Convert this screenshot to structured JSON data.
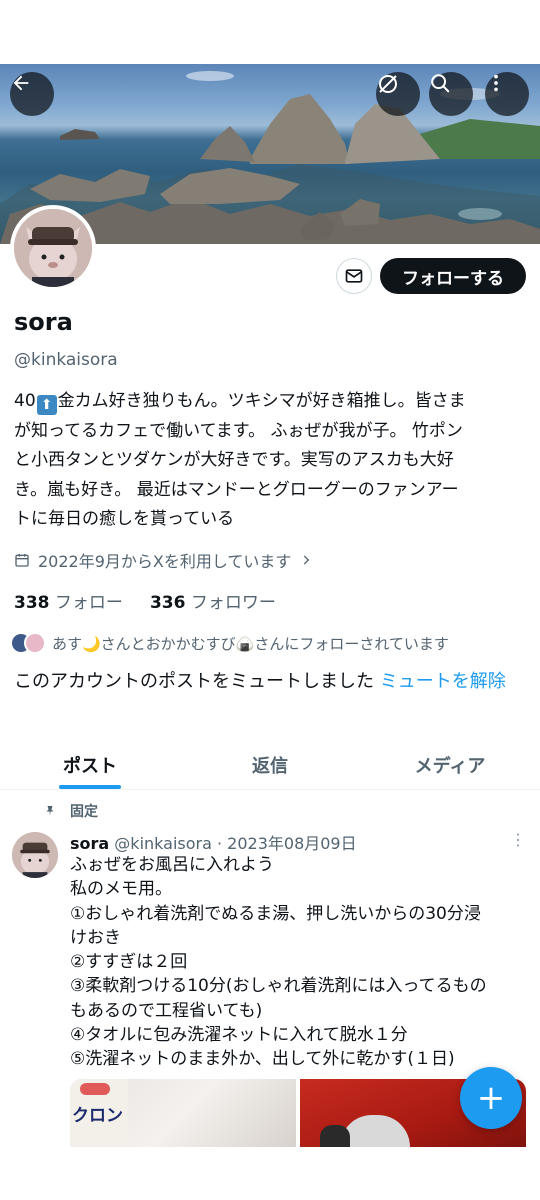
{
  "profile": {
    "name": "sora",
    "handle": "@kinkaisora",
    "follow_label": "フォローする",
    "bio_start": "40",
    "bio_up_emoji": "⬆",
    "bio_line1": "金カム好き独りもん。ツキシマが好き箱推し。皆さま",
    "bio_line2": "が知ってるカフェで働いてます。 ふぉぜが我が子。 竹ポン",
    "bio_line3": "と小西タンとツダケンが大好きです。実写のアスカも大好",
    "bio_line4": "き。嵐も好き。 最近はマンドーとグローグーのファンアー",
    "bio_line5": "トに毎日の癒しを貰っている",
    "joined": "2022年9月からXを利用しています",
    "following_count": "338",
    "following_label": "フォロー",
    "followers_count": "336",
    "followers_label": "フォロワー",
    "followed_by": "あす🌙さんとおかかむすび🍙さんにフォローされています",
    "muted_text": "このアカウントのポストをミュートしました",
    "unmute_label": "ミュートを解除"
  },
  "tabs": [
    {
      "label": "ポスト"
    },
    {
      "label": "返信"
    },
    {
      "label": "メディア"
    }
  ],
  "post": {
    "pinned_label": "固定",
    "author_name": "sora",
    "author_handle": "@kinkaisora",
    "separator": "·",
    "date": "2023年08月09日",
    "more": "⋮",
    "lines": [
      "ふぉぜをお風呂に入れよう",
      "私のメモ用。",
      "①おしゃれ着洗剤でぬるま湯、押し洗いからの30分浸",
      "けおき",
      "②すすぎは２回",
      "③柔軟剤つける10分(おしゃれ着洗剤には入ってるもの",
      "もあるので工程省いても)",
      "④タオルに包み洗濯ネットに入れて脱水１分",
      "⑤洗濯ネットのまま外か、出して外に乾かす(１日)"
    ],
    "media_text": "クロン"
  },
  "fab_label": "+",
  "icons": [
    "back-arrow-icon",
    "grok-icon",
    "search-icon",
    "more-vertical-icon",
    "mail-icon",
    "calendar-icon",
    "chevron-right-icon",
    "pin-icon"
  ],
  "colors": {
    "accent": "#1d9bf0",
    "text": "#0f1419",
    "secondary": "#536471",
    "follow_bg": "#0f1419"
  }
}
